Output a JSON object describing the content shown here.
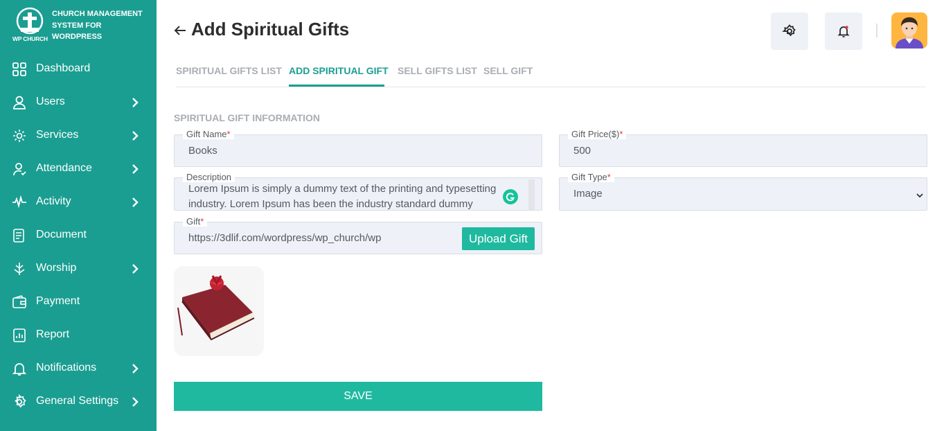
{
  "brand": {
    "logo_text": "WP CHURCH",
    "name": "CHURCH MANAGEMENT SYSTEM FOR WORDPRESS"
  },
  "sidebar": {
    "items": [
      {
        "label": "Dashboard",
        "icon": "dashboard-grid-icon",
        "has_submenu": false
      },
      {
        "label": "Users",
        "icon": "user-icon",
        "has_submenu": true
      },
      {
        "label": "Services",
        "icon": "services-gear-icon",
        "has_submenu": true
      },
      {
        "label": "Attendance",
        "icon": "attendance-user-icon",
        "has_submenu": true
      },
      {
        "label": "Activity",
        "icon": "activity-pulse-icon",
        "has_submenu": true
      },
      {
        "label": "Document",
        "icon": "document-icon",
        "has_submenu": false
      },
      {
        "label": "Worship",
        "icon": "worship-icon",
        "has_submenu": true
      },
      {
        "label": "Payment",
        "icon": "payment-wallet-icon",
        "has_submenu": false
      },
      {
        "label": "Report",
        "icon": "report-icon",
        "has_submenu": false
      },
      {
        "label": "Notifications",
        "icon": "bell-icon",
        "has_submenu": true
      },
      {
        "label": "General Settings",
        "icon": "gear-icon",
        "has_submenu": true
      }
    ]
  },
  "header": {
    "title": "Add Spiritual Gifts",
    "settings_icon": "gear-icon",
    "notification_icon": "bell-icon",
    "avatar_icon": "user-avatar"
  },
  "tabs": [
    {
      "label": "SPIRITUAL GIFTS LIST",
      "active": false
    },
    {
      "label": "ADD SPIRITUAL GIFT",
      "active": true
    },
    {
      "label": "SELL GIFTS LIST",
      "active": false
    },
    {
      "label": "SELL GIFT",
      "active": false
    }
  ],
  "form": {
    "section_title": "SPIRITUAL GIFT INFORMATION",
    "gift_name": {
      "label": "Gift Name",
      "value": "Books"
    },
    "gift_price": {
      "label": "Gift Price($)",
      "value": "500"
    },
    "description": {
      "label": "Description",
      "line1": "Lorem Ipsum is simply a dummy text of the printing and typesetting",
      "line2": "industry. Lorem Ipsum has been the industry standard dummy"
    },
    "gift_type": {
      "label": "Gift Type",
      "value": "Image"
    },
    "gift": {
      "label": "Gift",
      "value": "https://3dlif.com/wordpress/wp_church/wp"
    },
    "required_marker": "*",
    "upload_label": "Upload Gift",
    "save_label": "SAVE"
  },
  "colors": {
    "sidebar_bg": "#1a9e91",
    "accent": "#1fb9a0",
    "required": "#e03a3a"
  }
}
